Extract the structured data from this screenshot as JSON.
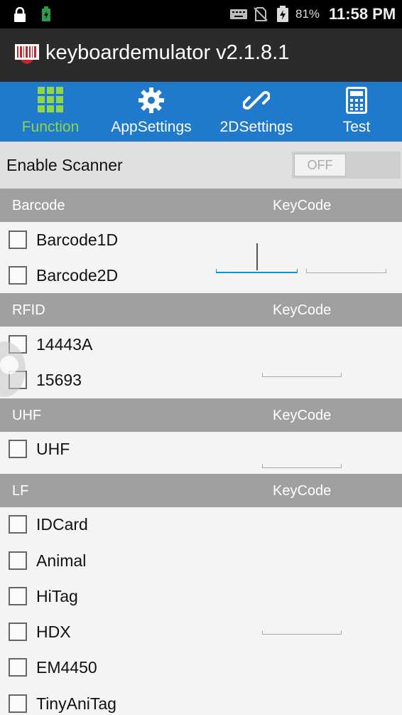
{
  "status_bar": {
    "battery_percent": "81%",
    "time": "11:58 PM",
    "icons": [
      "lock-icon",
      "battery-charging-small-icon",
      "keyboard-icon",
      "no-sim-icon",
      "battery-charging-icon"
    ]
  },
  "app_bar": {
    "title": "keyboardemulator v2.1.8.1",
    "icon": "barcode-scanner-icon"
  },
  "tabs": [
    {
      "label": "Function",
      "icon": "grid-icon",
      "active": true
    },
    {
      "label": "AppSettings",
      "icon": "gear-icon",
      "active": false
    },
    {
      "label": "2DSettings",
      "icon": "link-icon",
      "active": false
    },
    {
      "label": "Test",
      "icon": "calculator-icon",
      "active": false
    }
  ],
  "enable_scanner": {
    "label": "Enable Scanner",
    "toggle_text": "OFF"
  },
  "sections": {
    "barcode": {
      "header": "Barcode",
      "keycode_header": "KeyCode",
      "items": [
        "Barcode1D",
        "Barcode2D"
      ]
    },
    "rfid": {
      "header": "RFID",
      "keycode_header": "KeyCode",
      "items": [
        "14443A",
        "15693"
      ]
    },
    "uhf": {
      "header": "UHF",
      "keycode_header": "KeyCode",
      "items": [
        "UHF"
      ]
    },
    "lf": {
      "header": "LF",
      "keycode_header": "KeyCode",
      "items": [
        "IDCard",
        "Animal",
        "HiTag",
        "HDX",
        "EM4450",
        "TinyAniTag"
      ]
    }
  },
  "colors": {
    "tab_bar": "#1f7acb",
    "active_tab_text": "#8fd648",
    "section_header": "#a0a0a0",
    "focused_field": "#1a8fd0"
  }
}
